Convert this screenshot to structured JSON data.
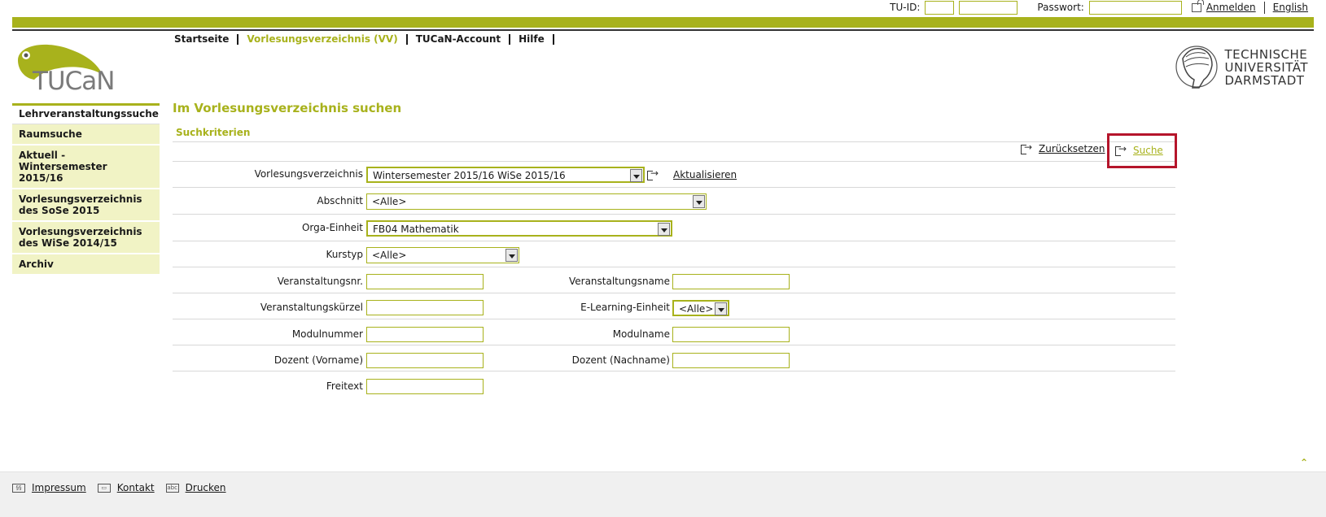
{
  "topbar": {
    "tuid_label": "TU-ID:",
    "password_label": "Passwort:",
    "login_link": "Anmelden",
    "language_link": "English"
  },
  "logo": {
    "text": "TUCaN"
  },
  "mainnav": [
    {
      "label": "Startseite",
      "active": false
    },
    {
      "label": "Vorlesungsverzeichnis (VV)",
      "active": true
    },
    {
      "label": "TUCaN-Account",
      "active": false
    },
    {
      "label": "Hilfe",
      "active": false
    }
  ],
  "university": {
    "line1": "TECHNISCHE",
    "line2": "UNIVERSITÄT",
    "line3": "DARMSTADT"
  },
  "sidebar": {
    "items": [
      {
        "label": "Lehrveranstaltungssuche"
      },
      {
        "label": "Raumsuche"
      },
      {
        "label": "Aktuell - Wintersemester 2015/16"
      },
      {
        "label": "Vorlesungsverzeichnis des SoSe 2015"
      },
      {
        "label": "Vorlesungsverzeichnis des WiSe 2014/15"
      },
      {
        "label": "Archiv"
      }
    ]
  },
  "main": {
    "title": "Im Vorlesungsverzeichnis suchen",
    "section": "Suchkriterien",
    "reset_link": "Zurücksetzen",
    "search_link": "Suche",
    "refresh_link": "Aktualisieren",
    "fields": {
      "vv_label": "Vorlesungsverzeichnis",
      "vv_value": "Wintersemester 2015/16 WiSe 2015/16",
      "abschnitt_label": "Abschnitt",
      "abschnitt_value": "<Alle>",
      "orga_label": "Orga-Einheit",
      "orga_value": "FB04 Mathematik",
      "kurstyp_label": "Kurstyp",
      "kurstyp_value": "<Alle>",
      "vnr_label": "Veranstaltungsnr.",
      "vname_label": "Veranstaltungsname",
      "vkuerzel_label": "Veranstaltungskürzel",
      "elearning_label": "E-Learning-Einheit",
      "elearning_value": "<Alle>",
      "modulnr_label": "Modulnummer",
      "modulname_label": "Modulname",
      "dozent_vorname_label": "Dozent (Vorname)",
      "dozent_nachname_label": "Dozent (Nachname)",
      "freitext_label": "Freitext"
    }
  },
  "footer": {
    "impressum": "Impressum",
    "kontakt": "Kontakt",
    "drucken": "Drucken"
  },
  "colors": {
    "accent": "#a8b21c",
    "highlight": "#b5152b",
    "sidebar_bg": "#f1f3c5"
  }
}
